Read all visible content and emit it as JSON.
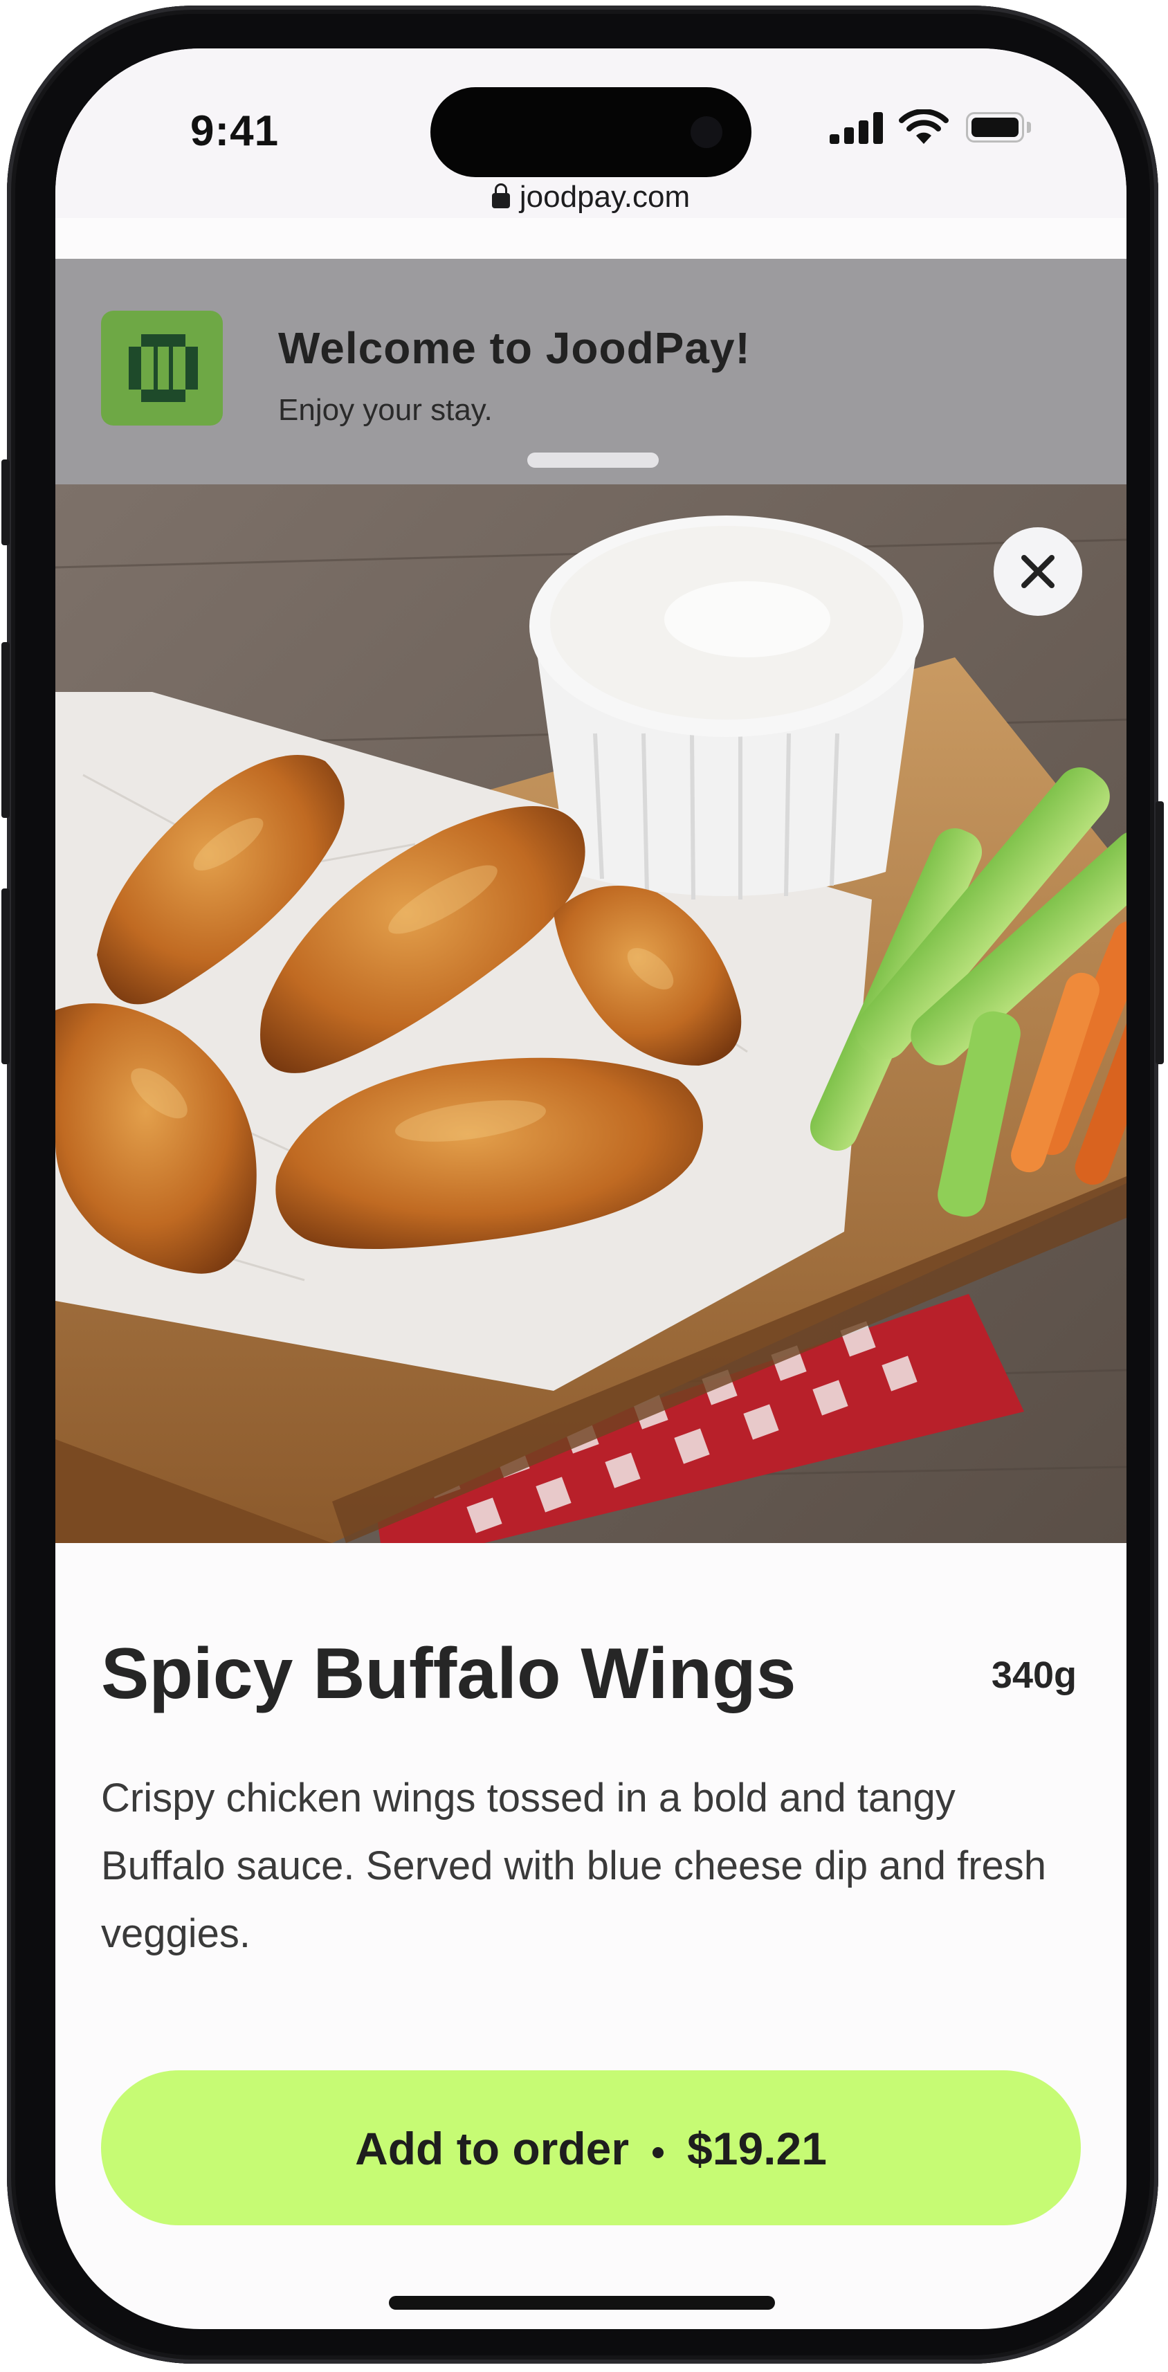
{
  "status_bar": {
    "time": "9:41",
    "icons": [
      "cellular-signal-icon",
      "wifi-icon",
      "battery-icon"
    ]
  },
  "browser": {
    "url": "joodpay.com",
    "lock_icon": "lock-icon"
  },
  "banner": {
    "title": "Welcome to JoodPay!",
    "subtitle": "Enjoy your stay.",
    "logo_icon": "joodpay-logo",
    "logo_color": "#6ea845"
  },
  "hero": {
    "close_icon": "close-icon"
  },
  "product": {
    "name": "Spicy Buffalo Wings",
    "weight": "340g",
    "description": "Crispy chicken wings tossed in a bold and tangy Buffalo sauce. Served with blue cheese dip and fresh veggies."
  },
  "cta": {
    "label": "Add to order",
    "price": "$19.21",
    "color": "#c6fb74"
  }
}
